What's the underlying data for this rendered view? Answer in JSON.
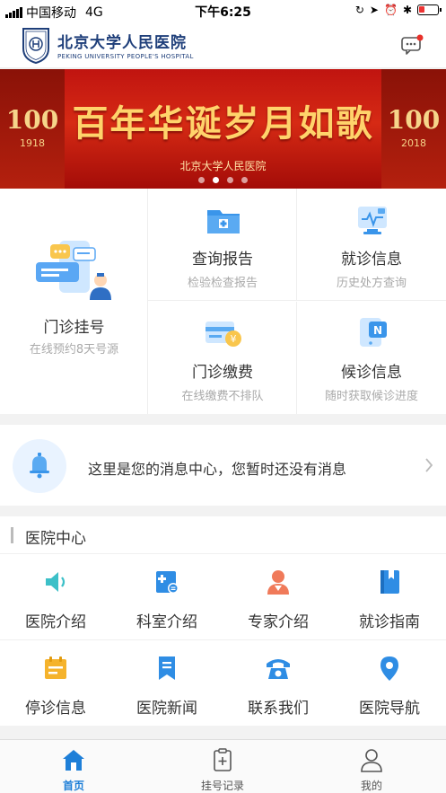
{
  "status_bar": {
    "carrier": "中国移动",
    "network": "4G",
    "time": "下午6:25"
  },
  "header": {
    "hospital_name_cn": "北京大学人民医院",
    "hospital_name_en": "PEKING UNIVERSITY PEOPLE'S HOSPITAL",
    "icons": [
      "hospital-logo",
      "message-icon"
    ]
  },
  "banner": {
    "title": "百年华诞岁月如歌",
    "subtitle": "北京大学人民医院",
    "left_badge": "100",
    "left_year": "1918",
    "right_badge": "100",
    "right_year": "2018",
    "slide_count": 4,
    "active_slide": 2
  },
  "services": {
    "main": {
      "title": "门诊挂号",
      "subtitle": "在线预约8天号源",
      "icon": "appointment-phone-icon"
    },
    "items": [
      {
        "title": "查询报告",
        "subtitle": "检验检查报告",
        "icon": "report-folder-icon"
      },
      {
        "title": "就诊信息",
        "subtitle": "历史处方查询",
        "icon": "visit-info-icon"
      },
      {
        "title": "门诊缴费",
        "subtitle": "在线缴费不排队",
        "icon": "payment-card-icon"
      },
      {
        "title": "候诊信息",
        "subtitle": "随时获取候诊进度",
        "icon": "queue-notice-icon"
      }
    ]
  },
  "notice": {
    "text": "这里是您的消息中心，您暂时还没有消息",
    "icon": "bell-icon"
  },
  "hospital_center": {
    "title": "医院中心",
    "items": [
      {
        "label": "医院介绍",
        "icon": "speaker-icon",
        "color": "#3cc0c8"
      },
      {
        "label": "科室介绍",
        "icon": "department-icon",
        "color": "#2f8de4"
      },
      {
        "label": "专家介绍",
        "icon": "doctor-icon",
        "color": "#f07a5a"
      },
      {
        "label": "就诊指南",
        "icon": "guide-book-icon",
        "color": "#2f8de4"
      },
      {
        "label": "停诊信息",
        "icon": "calendar-icon",
        "color": "#f5b32c"
      },
      {
        "label": "医院新闻",
        "icon": "news-bookmark-icon",
        "color": "#2f8de4"
      },
      {
        "label": "联系我们",
        "icon": "telephone-icon",
        "color": "#2f8de4"
      },
      {
        "label": "医院导航",
        "icon": "location-pin-icon",
        "color": "#2f8de4"
      }
    ]
  },
  "tab_bar": {
    "tabs": [
      {
        "label": "首页",
        "icon": "home-icon",
        "active": true
      },
      {
        "label": "挂号记录",
        "icon": "clipboard-plus-icon",
        "active": false
      },
      {
        "label": "我的",
        "icon": "user-icon",
        "active": false
      }
    ]
  },
  "colors": {
    "primary": "#1e7fd8",
    "banner_red": "#c01410",
    "banner_gold": "#ffd36b"
  }
}
